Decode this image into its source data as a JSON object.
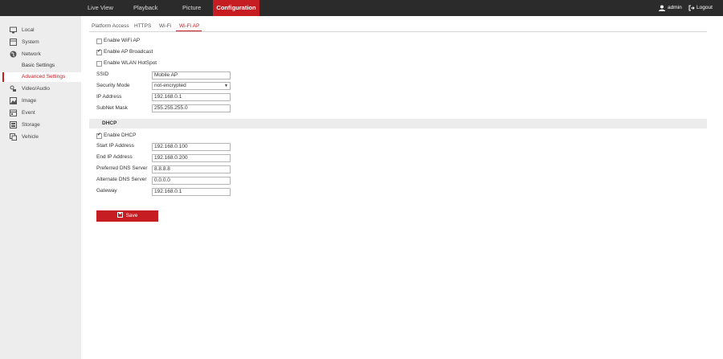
{
  "topnav": {
    "items": [
      {
        "label": "Live View",
        "active": false
      },
      {
        "label": "Playback",
        "active": false
      },
      {
        "label": "Picture",
        "active": false
      },
      {
        "label": "Configuration",
        "active": true
      }
    ],
    "user": "admin",
    "logout": "Logout"
  },
  "sidebar": {
    "items": [
      {
        "label": "Local",
        "icon": "monitor-icon"
      },
      {
        "label": "System",
        "icon": "system-icon"
      },
      {
        "label": "Network",
        "icon": "globe-icon"
      },
      {
        "label": "Video/Audio",
        "icon": "video-audio-icon"
      },
      {
        "label": "Image",
        "icon": "image-icon"
      },
      {
        "label": "Event",
        "icon": "event-icon"
      },
      {
        "label": "Storage",
        "icon": "storage-icon"
      },
      {
        "label": "Vehicle",
        "icon": "vehicle-icon"
      }
    ],
    "network_sub": [
      {
        "label": "Basic Settings",
        "active": false
      },
      {
        "label": "Advanced Settings",
        "active": true
      }
    ]
  },
  "tabs": [
    {
      "label": "Platform Access",
      "active": false
    },
    {
      "label": "HTTPS",
      "active": false
    },
    {
      "label": "Wi-Fi",
      "active": false
    },
    {
      "label": "Wi-Fi AP",
      "active": true
    }
  ],
  "checkboxes": {
    "enable_wifi_ap": {
      "label": "Enable WiFi AP",
      "checked": false
    },
    "enable_ap_broadcast": {
      "label": "Enable AP Broadcast",
      "checked": true
    },
    "enable_wlan_hotspot": {
      "label": "Enable WLAN HotSpot",
      "checked": false
    },
    "enable_dhcp": {
      "label": "Enable DHCP",
      "checked": true
    }
  },
  "form": {
    "ssid": {
      "label": "SSID",
      "value": "Mobile AP"
    },
    "security_mode": {
      "label": "Security Mode",
      "value": "not-encrypted"
    },
    "ip_address": {
      "label": "IP Address",
      "value": "192.168.0.1"
    },
    "subnet_mask": {
      "label": "SubNet Mask",
      "value": "255.255.255.0"
    }
  },
  "dhcp": {
    "section_title": "DHCP",
    "start_ip": {
      "label": "Start IP Address",
      "value": "192.168.0.100"
    },
    "end_ip": {
      "label": "End IP Address",
      "value": "192.168.0.200"
    },
    "preferred_dns": {
      "label": "Preferred DNS Server",
      "value": "8.8.8.8"
    },
    "alternate_dns": {
      "label": "Alternate DNS Server",
      "value": "0.0.0.0"
    },
    "gateway": {
      "label": "Gateway",
      "value": "192.168.0.1"
    }
  },
  "save_label": "Save",
  "colors": {
    "accent": "#c61d23",
    "topbar": "#2b2b2b",
    "sidebar": "#ededed"
  }
}
